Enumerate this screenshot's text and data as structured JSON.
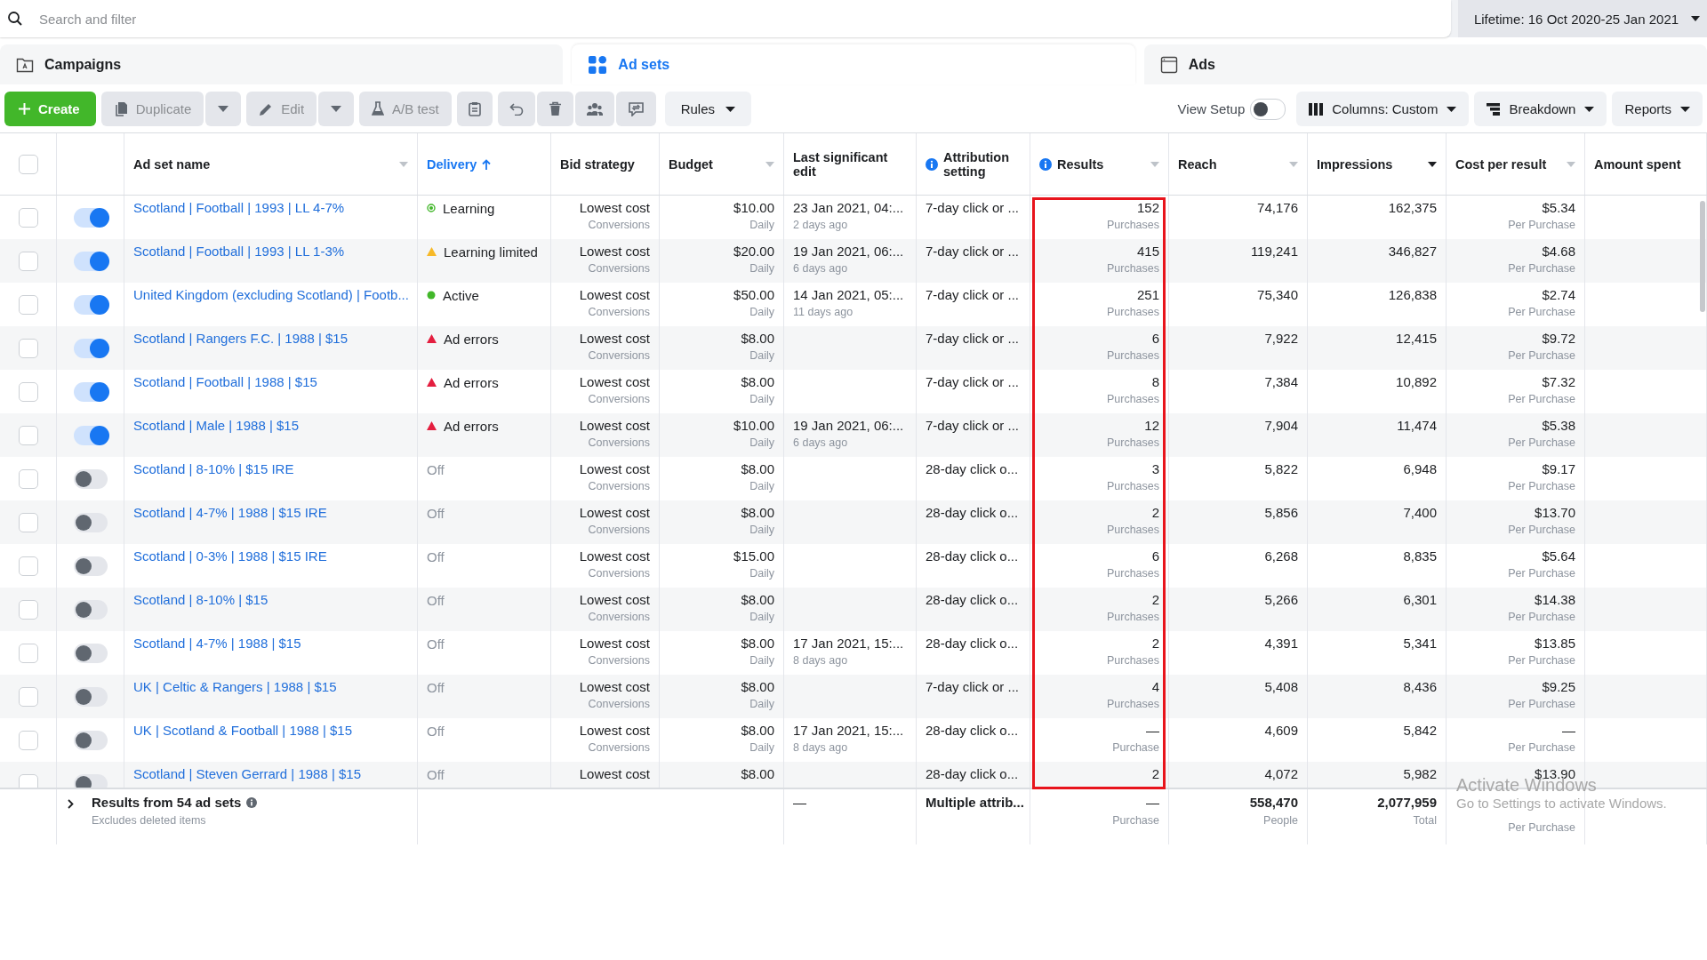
{
  "search": {
    "placeholder": "Search and filter"
  },
  "date_range": "Lifetime: 16 Oct 2020-25 Jan 2021",
  "tabs": [
    {
      "label": "Campaigns",
      "selected": false,
      "kind": "folder"
    },
    {
      "label": "Ad sets",
      "selected": true,
      "kind": "grid"
    },
    {
      "label": "Ads",
      "selected": false,
      "kind": "page"
    }
  ],
  "toolbar": {
    "create": "Create",
    "duplicate": {
      "label": "Duplicate",
      "disabled": true
    },
    "edit": {
      "label": "Edit",
      "disabled": true
    },
    "ab_test": {
      "label": "A/B test",
      "disabled": true
    },
    "rules": "Rules",
    "view_setup": {
      "label": "View Setup",
      "on": false
    },
    "columns": "Columns: Custom",
    "breakdown": "Breakdown",
    "reports": "Reports"
  },
  "select_all": {
    "checked": false
  },
  "columns": [
    {
      "label": "Ad set name",
      "menu": true,
      "sorted": false
    },
    {
      "label": "Delivery",
      "sorted": true
    },
    {
      "label": "Bid strategy",
      "sorted": false
    },
    {
      "label": "Budget",
      "menu": true,
      "sorted": false
    },
    {
      "label": "Last significant edit",
      "sorted": false
    },
    {
      "label": "Attribution setting",
      "sorted": false,
      "info": true
    },
    {
      "label": "Results",
      "menu": true,
      "sorted": false,
      "info": true,
      "highlighted": true
    },
    {
      "label": "Reach",
      "menu": true,
      "sorted": false
    },
    {
      "label": "Impressions",
      "menu": true,
      "sorted": false
    },
    {
      "label": "Cost per result",
      "menu": true,
      "sorted": false
    },
    {
      "label": "Amount spent",
      "sorted": false
    }
  ],
  "rows": [
    {
      "checked": false,
      "on": true,
      "name": "Scotland | Football | 1993 | LL 4-7%",
      "delivery": {
        "kind": "learning",
        "text": "Learning"
      },
      "bid": "Lowest cost",
      "bid_sub": "Conversions",
      "budget": "$10.00",
      "budget_sub": "Daily",
      "last_edit": "23 Jan 2021, 04:...",
      "last_edit_sub": "2 days ago",
      "attribution": "7-day click or ...",
      "results": "152",
      "results_sub": "Purchases",
      "reach": "74,176",
      "impressions": "162,375",
      "cost": "$5.34",
      "cost_sub": "Per Purchase"
    },
    {
      "checked": false,
      "on": true,
      "name": "Scotland | Football | 1993 | LL 1-3%",
      "delivery": {
        "kind": "limited",
        "text": "Learning limited"
      },
      "bid": "Lowest cost",
      "bid_sub": "Conversions",
      "budget": "$20.00",
      "budget_sub": "Daily",
      "last_edit": "19 Jan 2021, 06:...",
      "last_edit_sub": "6 days ago",
      "attribution": "7-day click or ...",
      "results": "415",
      "results_sub": "Purchases",
      "reach": "119,241",
      "impressions": "346,827",
      "cost": "$4.68",
      "cost_sub": "Per Purchase"
    },
    {
      "checked": false,
      "on": true,
      "name": "United Kingdom (excluding Scotland) | Footb...",
      "delivery": {
        "kind": "active",
        "text": "Active"
      },
      "bid": "Lowest cost",
      "bid_sub": "Conversions",
      "budget": "$50.00",
      "budget_sub": "Daily",
      "last_edit": "14 Jan 2021, 05:...",
      "last_edit_sub": "11 days ago",
      "attribution": "7-day click or ...",
      "results": "251",
      "results_sub": "Purchases",
      "reach": "75,340",
      "impressions": "126,838",
      "cost": "$2.74",
      "cost_sub": "Per Purchase"
    },
    {
      "checked": false,
      "on": true,
      "name": "Scotland | Rangers F.C. | 1988 | $15",
      "delivery": {
        "kind": "error",
        "text": "Ad errors"
      },
      "bid": "Lowest cost",
      "bid_sub": "Conversions",
      "budget": "$8.00",
      "budget_sub": "Daily",
      "attribution": "7-day click or ...",
      "results": "6",
      "results_sub": "Purchases",
      "reach": "7,922",
      "impressions": "12,415",
      "cost": "$9.72",
      "cost_sub": "Per Purchase"
    },
    {
      "checked": false,
      "on": true,
      "name": "Scotland | Football | 1988 | $15",
      "delivery": {
        "kind": "error",
        "text": "Ad errors"
      },
      "bid": "Lowest cost",
      "bid_sub": "Conversions",
      "budget": "$8.00",
      "budget_sub": "Daily",
      "attribution": "7-day click or ...",
      "results": "8",
      "results_sub": "Purchases",
      "reach": "7,384",
      "impressions": "10,892",
      "cost": "$7.32",
      "cost_sub": "Per Purchase"
    },
    {
      "checked": false,
      "on": true,
      "name": "Scotland | Male | 1988 | $15",
      "delivery": {
        "kind": "error",
        "text": "Ad errors"
      },
      "bid": "Lowest cost",
      "bid_sub": "Conversions",
      "budget": "$10.00",
      "budget_sub": "Daily",
      "last_edit": "19 Jan 2021, 06:...",
      "last_edit_sub": "6 days ago",
      "attribution": "7-day click or ...",
      "results": "12",
      "results_sub": "Purchases",
      "reach": "7,904",
      "impressions": "11,474",
      "cost": "$5.38",
      "cost_sub": "Per Purchase"
    },
    {
      "checked": false,
      "on": false,
      "name": "Scotland | 8-10% | $15 IRE",
      "delivery": {
        "kind": "off",
        "text": "Off"
      },
      "bid": "Lowest cost",
      "bid_sub": "Conversions",
      "budget": "$8.00",
      "budget_sub": "Daily",
      "attribution": "28-day click o...",
      "results": "3",
      "results_sub": "Purchases",
      "reach": "5,822",
      "impressions": "6,948",
      "cost": "$9.17",
      "cost_sub": "Per Purchase"
    },
    {
      "checked": false,
      "on": false,
      "name": "Scotland | 4-7% | 1988 | $15 IRE",
      "delivery": {
        "kind": "off",
        "text": "Off"
      },
      "bid": "Lowest cost",
      "bid_sub": "Conversions",
      "budget": "$8.00",
      "budget_sub": "Daily",
      "attribution": "28-day click o...",
      "results": "2",
      "results_sub": "Purchases",
      "reach": "5,856",
      "impressions": "7,400",
      "cost": "$13.70",
      "cost_sub": "Per Purchase"
    },
    {
      "checked": false,
      "on": false,
      "name": "Scotland | 0-3% | 1988 | $15 IRE",
      "delivery": {
        "kind": "off",
        "text": "Off"
      },
      "bid": "Lowest cost",
      "bid_sub": "Conversions",
      "budget": "$15.00",
      "budget_sub": "Daily",
      "attribution": "28-day click o...",
      "results": "6",
      "results_sub": "Purchases",
      "reach": "6,268",
      "impressions": "8,835",
      "cost": "$5.64",
      "cost_sub": "Per Purchase"
    },
    {
      "checked": false,
      "on": false,
      "name": "Scotland | 8-10% | $15",
      "delivery": {
        "kind": "off",
        "text": "Off"
      },
      "bid": "Lowest cost",
      "bid_sub": "Conversions",
      "budget": "$8.00",
      "budget_sub": "Daily",
      "attribution": "28-day click o...",
      "results": "2",
      "results_sub": "Purchases",
      "reach": "5,266",
      "impressions": "6,301",
      "cost": "$14.38",
      "cost_sub": "Per Purchase"
    },
    {
      "checked": false,
      "on": false,
      "name": "Scotland | 4-7% | 1988 | $15",
      "delivery": {
        "kind": "off",
        "text": "Off"
      },
      "bid": "Lowest cost",
      "bid_sub": "Conversions",
      "budget": "$8.00",
      "budget_sub": "Daily",
      "last_edit": "17 Jan 2021, 15:...",
      "last_edit_sub": "8 days ago",
      "attribution": "28-day click o...",
      "results": "2",
      "results_sub": "Purchases",
      "reach": "4,391",
      "impressions": "5,341",
      "cost": "$13.85",
      "cost_sub": "Per Purchase"
    },
    {
      "checked": false,
      "on": false,
      "name": "UK | Celtic & Rangers | 1988 | $15",
      "delivery": {
        "kind": "off",
        "text": "Off"
      },
      "bid": "Lowest cost",
      "bid_sub": "Conversions",
      "budget": "$8.00",
      "budget_sub": "Daily",
      "attribution": "7-day click or ...",
      "results": "4",
      "results_sub": "Purchases",
      "reach": "5,408",
      "impressions": "8,436",
      "cost": "$9.25",
      "cost_sub": "Per Purchase"
    },
    {
      "checked": false,
      "on": false,
      "name": "UK | Scotland & Football | 1988 | $15",
      "delivery": {
        "kind": "off",
        "text": "Off"
      },
      "bid": "Lowest cost",
      "bid_sub": "Conversions",
      "budget": "$8.00",
      "budget_sub": "Daily",
      "last_edit": "17 Jan 2021, 15:...",
      "last_edit_sub": "8 days ago",
      "attribution": "28-day click o...",
      "results": "—",
      "results_sub": "Purchase",
      "reach": "4,609",
      "impressions": "5,842",
      "cost": "—",
      "cost_sub": "Per Purchase"
    },
    {
      "checked": false,
      "on": false,
      "name": "Scotland | Steven Gerrard | 1988 | $15",
      "delivery": {
        "kind": "off",
        "text": "Off"
      },
      "bid": "Lowest cost",
      "budget": "$8.00",
      "attribution": "28-day click o...",
      "results": "2",
      "reach": "4,072",
      "impressions": "5,982",
      "cost": "$13.90"
    }
  ],
  "summary": {
    "title": "Results from 54 ad sets",
    "note": "Excludes deleted items",
    "last_edit": "—",
    "attribution": "Multiple attrib...",
    "results": "—",
    "results_sub": "Purchase",
    "reach": "558,470",
    "reach_sub": "People",
    "impressions": "2,077,959",
    "impressions_sub": "Total",
    "cost_sub": "Per Purchase"
  },
  "os_notice": {
    "title": "Activate Windows",
    "text": "Go to Settings to activate Windows."
  }
}
